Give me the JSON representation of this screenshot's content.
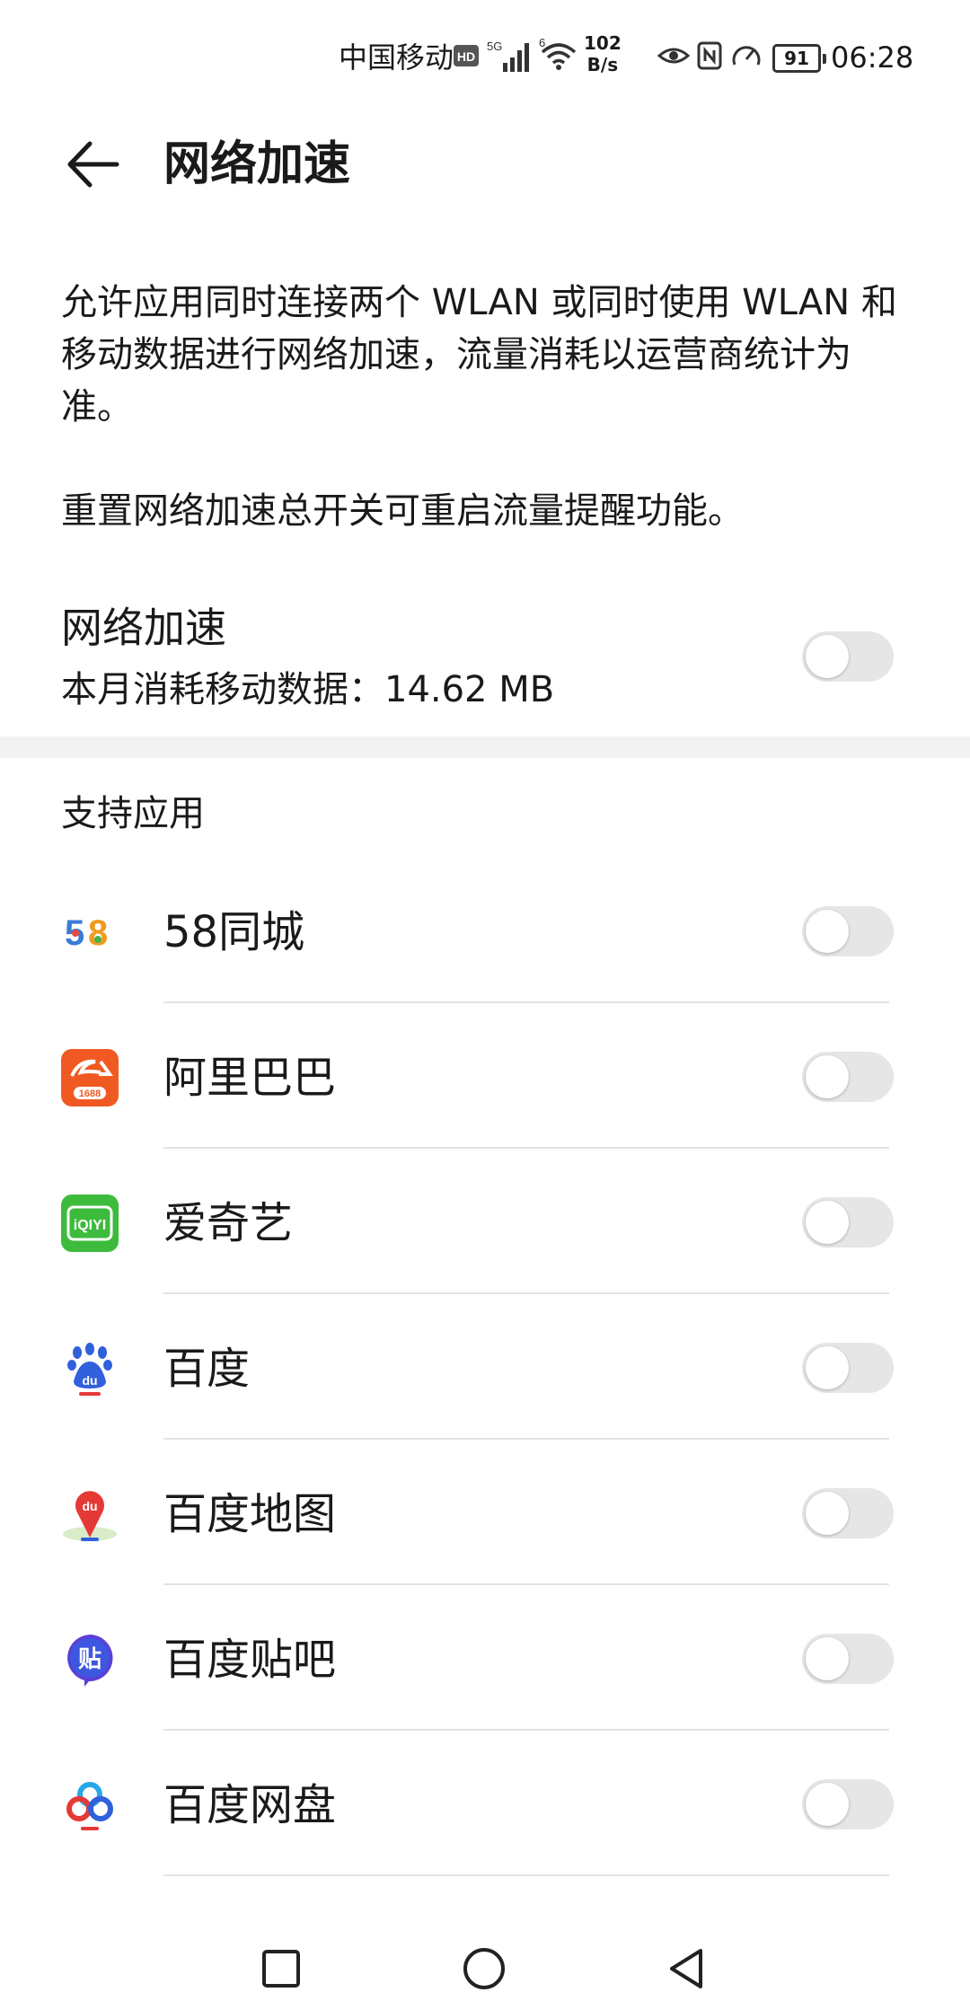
{
  "status_bar": {
    "carrier": "中国移动",
    "hd": "HD",
    "network": "5G",
    "wifi_gen": "6",
    "speed_value": "102",
    "speed_unit": "B/s",
    "battery": "91",
    "time": "06:28"
  },
  "header": {
    "title": "网络加速",
    "back_icon": "arrow-left-icon"
  },
  "description": {
    "para1": "允许应用同时连接两个 WLAN 或同时使用 WLAN 和移动数据进行网络加速，流量消耗以运营商统计为准。",
    "para2": "重置网络加速总开关可重启流量提醒功能。"
  },
  "accelerate": {
    "title": "网络加速",
    "usage": "本月消耗移动数据：14.62 MB",
    "enabled": false
  },
  "apps_section": {
    "title": "支持应用",
    "apps": [
      {
        "name": "58同城",
        "icon": "58tongcheng-icon",
        "enabled": false
      },
      {
        "name": "阿里巴巴",
        "icon": "alibaba-1688-icon",
        "enabled": false
      },
      {
        "name": "爱奇艺",
        "icon": "iqiyi-icon",
        "enabled": false
      },
      {
        "name": "百度",
        "icon": "baidu-icon",
        "enabled": false
      },
      {
        "name": "百度地图",
        "icon": "baidu-map-icon",
        "enabled": false
      },
      {
        "name": "百度贴吧",
        "icon": "baidu-tieba-icon",
        "enabled": false
      },
      {
        "name": "百度网盘",
        "icon": "baidu-netdisk-icon",
        "enabled": false
      }
    ]
  },
  "icon_labels": {
    "alibaba": "1688",
    "iqiyi": "iQIYI",
    "baidu": "du",
    "tieba": "贴"
  },
  "colors": {
    "toggle_off": "#e6e6e6",
    "alibaba": "#f05a22",
    "iqiyi": "#3dbb3d",
    "baidu_blue": "#3060dc",
    "tieba": "#5b3fd6"
  },
  "nav_bar": {
    "items": [
      "square-icon",
      "circle-icon",
      "triangle-back-icon"
    ]
  }
}
